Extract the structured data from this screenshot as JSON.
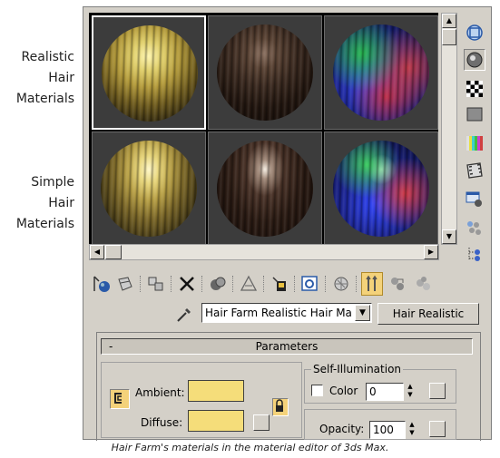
{
  "labels": {
    "realistic": [
      "Realistic",
      "Hair",
      "Materials"
    ],
    "simple": [
      "Simple",
      "Hair",
      "Materials"
    ]
  },
  "slots": [
    {
      "material": "gold-realistic",
      "selected": true
    },
    {
      "material": "brown-realistic",
      "selected": false
    },
    {
      "material": "rgb-realistic",
      "selected": false
    },
    {
      "material": "gold-simple",
      "selected": false
    },
    {
      "material": "brown-simple",
      "selected": false
    },
    {
      "material": "rgb-simple",
      "selected": false
    }
  ],
  "side_tools": [
    "sample-type-icon",
    "backlight-icon",
    "checker-background-icon",
    "sample-uv-tiling-icon",
    "video-color-check-icon",
    "make-preview-icon",
    "options-icon",
    "select-by-material-icon",
    "material-map-navigator-icon"
  ],
  "toolbar": [
    "get-material-icon",
    "put-to-scene-icon",
    "assign-to-selection-icon",
    "reset-map-icon",
    "make-unique-icon",
    "put-to-library-icon",
    "material-effects-channel-icon",
    "show-map-in-viewport-icon",
    "show-end-result-icon",
    "go-to-parent-icon",
    "go-forward-to-sibling-icon"
  ],
  "material": {
    "name": "Hair Farm Realistic Hair Ma",
    "type_button": "Hair Realistic"
  },
  "parameters": {
    "minus": "-",
    "title": "Parameters",
    "ambient_label": "Ambient:",
    "diffuse_label": "Diffuse:",
    "ambient_color": "#f5dd7a",
    "diffuse_color": "#f5dd7a",
    "self_illum_title": "Self-Illumination",
    "color_label": "Color",
    "color_value": "0",
    "opacity_label": "Opacity:",
    "opacity_value": "100"
  },
  "caption": "Hair Farm's materials in the material editor of 3ds Max."
}
